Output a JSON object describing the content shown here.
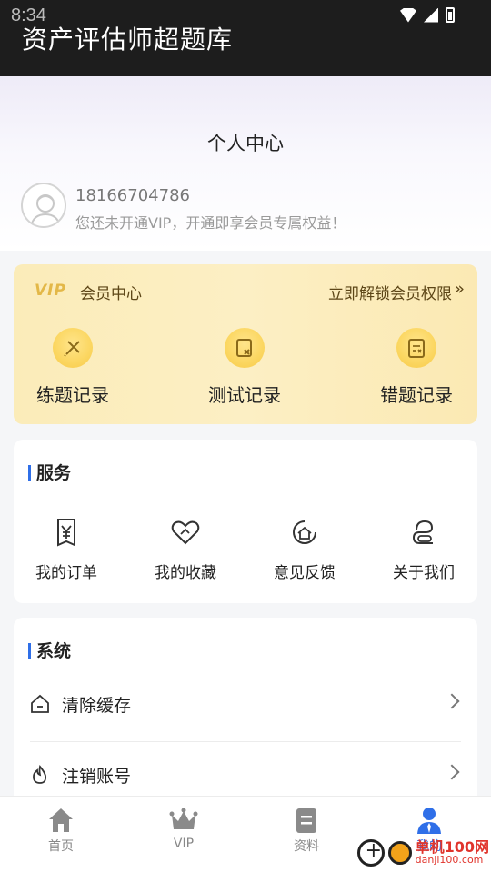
{
  "status_bar": {
    "time": "8:34"
  },
  "app_bar": {
    "title": "资产评估师超题库"
  },
  "header": {
    "page_title": "个人中心"
  },
  "user": {
    "phone": "18166704786",
    "subtitle": "您还未开通VIP，开通即享会员专属权益！"
  },
  "vip_card": {
    "logo_text": "VIP",
    "title": "会员中心",
    "unlock_text": "立即解锁会员权限",
    "items": [
      {
        "label": "练题记录",
        "icon": "pencil-ruler-icon"
      },
      {
        "label": "测试记录",
        "icon": "test-record-icon"
      },
      {
        "label": "错题记录",
        "icon": "clipboard-wrong-icon"
      }
    ]
  },
  "services": {
    "title": "服务",
    "items": [
      {
        "label": "我的订单",
        "icon": "yuan-receipt-icon"
      },
      {
        "label": "我的收藏",
        "icon": "heart-hand-icon"
      },
      {
        "label": "意见反馈",
        "icon": "feedback-icon"
      },
      {
        "label": "关于我们",
        "icon": "about-icon"
      }
    ]
  },
  "system": {
    "title": "系统",
    "items": [
      {
        "label": "清除缓存",
        "icon": "house-clear-icon"
      },
      {
        "label": "注销账号",
        "icon": "flame-icon"
      }
    ]
  },
  "bottom_nav": {
    "items": [
      {
        "label": "首页",
        "icon": "home-icon"
      },
      {
        "label": "VIP",
        "icon": "crown-icon"
      },
      {
        "label": "资料",
        "icon": "document-icon"
      },
      {
        "label": "我的",
        "icon": "person-icon"
      }
    ],
    "active_index": 3
  },
  "watermark": {
    "text": "单机100网",
    "sub": "danji100.com"
  },
  "colors": {
    "accent": "#2f6fe8",
    "vip_gold": "#fbd660",
    "vip_bg": "#fcefc4"
  }
}
